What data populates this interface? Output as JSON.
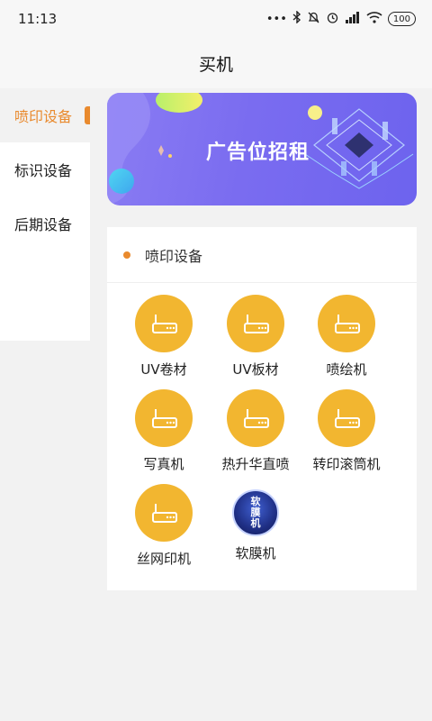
{
  "status_bar": {
    "time": "11:13",
    "dots": "•••",
    "battery": "100"
  },
  "nav": {
    "title": "买机"
  },
  "sidebar": {
    "items": [
      {
        "label": "喷印设备",
        "active": true
      },
      {
        "label": "标识设备",
        "active": false
      },
      {
        "label": "后期设备",
        "active": false
      }
    ]
  },
  "banner": {
    "text": "广告位招租"
  },
  "panel": {
    "title": "喷印设备",
    "items": [
      {
        "label": "UV卷材",
        "icon": "printer-icon"
      },
      {
        "label": "UV板材",
        "icon": "printer-icon"
      },
      {
        "label": "喷绘机",
        "icon": "printer-icon"
      },
      {
        "label": "写真机",
        "icon": "printer-icon"
      },
      {
        "label": "热升华直喷",
        "icon": "printer-icon"
      },
      {
        "label": "转印滚筒机",
        "icon": "printer-icon"
      },
      {
        "label": "丝网印机",
        "icon": "printer-icon"
      },
      {
        "label": "软膜机",
        "icon": "film-logo-icon",
        "icon_text": [
          "软",
          "膜",
          "机"
        ]
      }
    ]
  },
  "colors": {
    "accent": "#e98a2e",
    "icon_bg": "#f2b630",
    "banner": "#7a6cf0"
  }
}
